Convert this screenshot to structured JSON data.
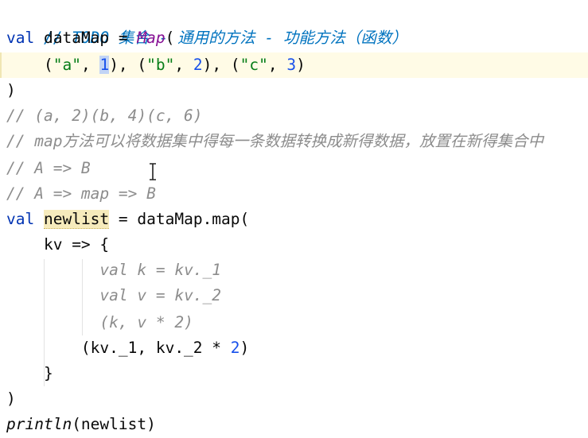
{
  "code": {
    "l1": "// TODO 集合 - 通用的方法 - 功能方法（函数）",
    "l2_kw": "val",
    "l2_name": "dataMap",
    "l2_eq": " = ",
    "l2_fn": "Map",
    "l2_open": "(",
    "l3": {
      "open1": "(",
      "s1": "\"a\"",
      "sep1": ", ",
      "n1": "1",
      "close1": "), (",
      "s2": "\"b\"",
      "sep2": ", ",
      "n2": "2",
      "close2": "), (",
      "s3": "\"c\"",
      "sep3": ", ",
      "n3": "3",
      "close3": ")"
    },
    "l4": ")",
    "l5": "// (a, 2)(b, 4)(c, 6)",
    "l6": "// map方法可以将数据集中得每一条数据转换成新得数据，放置在新得集合中",
    "l7": "// A => B",
    "l8": "// A => map => B",
    "l9_kw": "val",
    "l9_name": "newlist",
    "l9_rest": " = dataMap.map(",
    "l10": "kv => {",
    "l11": "val k = kv._1",
    "l12": "val v = kv._2",
    "l13": "(k, v * 2)",
    "l14_a": "(kv._1, kv._2 * ",
    "l14_n": "2",
    "l14_b": ")",
    "l15": "}",
    "l16": ")",
    "l17_fn": "println",
    "l17_rest": "(newlist)"
  },
  "colors": {
    "keyword": "#0033b3",
    "string": "#067d17",
    "number": "#1750eb",
    "comment": "#8c8c8c",
    "todo": "#0073bf",
    "function": "#871094"
  }
}
